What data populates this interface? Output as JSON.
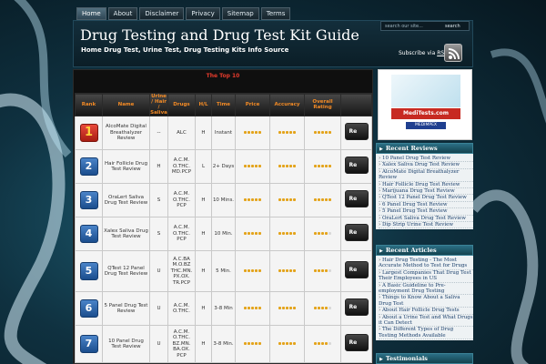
{
  "nav": [
    "Home",
    "About",
    "Disclaimer",
    "Privacy",
    "Sitemap",
    "Terms"
  ],
  "header": {
    "title": "Drug Testing and Drug Test Kit Guide",
    "tagline": "Home Drug Test, Urine Test, Drug Testing Kits Info Source",
    "search_placeholder": "search our site...",
    "search_button": "search",
    "subscribe_text": "Subscribe via",
    "rss_text": "RSS"
  },
  "table": {
    "heading": "The Top 10",
    "columns": [
      "Rank",
      "Name",
      "Urine / Hair / Saliva",
      "Drugs",
      "H/L",
      "Time",
      "Price",
      "Accuracy",
      "Overall Rating",
      ""
    ],
    "review_label": "Re",
    "rows": [
      {
        "rank": "1",
        "name": "AlcoMate Digital Breathalyzer Review",
        "type": "--",
        "drugs": "ALC",
        "hl": "H",
        "time": "Instant",
        "price_stars": 5,
        "accuracy_stars": 5,
        "overall_stars": 5
      },
      {
        "rank": "2",
        "name": "Hair Follicle Drug Test Review",
        "type": "H",
        "drugs": "A.C.M. O.THC. MD.PCP",
        "hl": "L",
        "time": "2+ Days",
        "price_stars": 5,
        "accuracy_stars": 5,
        "overall_stars": 5
      },
      {
        "rank": "3",
        "name": "OraLert Saliva Drug Test Review",
        "type": "S",
        "drugs": "A.C.M. O.THC. PCP",
        "hl": "H",
        "time": "10 Mins.",
        "price_stars": 5,
        "accuracy_stars": 5,
        "overall_stars": 5
      },
      {
        "rank": "4",
        "name": "Xalex Saliva Drug Test Review",
        "type": "S",
        "drugs": "A.C.M. O.THC. PCP",
        "hl": "H",
        "time": "10 Min.",
        "price_stars": 5,
        "accuracy_stars": 5,
        "overall_stars": 4
      },
      {
        "rank": "5",
        "name": "QTest 12 Panel Drug Test Review",
        "type": "U",
        "drugs": "A.C.BA M.O.BZ THC.MN. PX.OX. TR.PCP",
        "hl": "H",
        "time": "5 Min.",
        "price_stars": 5,
        "accuracy_stars": 5,
        "overall_stars": 4
      },
      {
        "rank": "6",
        "name": "5 Panel Drug Test Review",
        "type": "U",
        "drugs": "A.C.M. O.THC.",
        "hl": "H",
        "time": "3-8 Min",
        "price_stars": 5,
        "accuracy_stars": 5,
        "overall_stars": 4
      },
      {
        "rank": "7",
        "name": "10 Panel Drug Test Review",
        "type": "U",
        "drugs": "A.C.M. O.THC. BZ.MN. BA.OX. PCP",
        "hl": "H",
        "time": "3-8 Min.",
        "price_stars": 5,
        "accuracy_stars": 5,
        "overall_stars": 4
      }
    ]
  },
  "ad": {
    "site": "MediTests.com",
    "brand": "MEDIMPEX"
  },
  "sidebar": {
    "recent_reviews_title": "Recent Reviews",
    "recent_reviews": [
      "10 Panel Drug Test Review",
      "Xalex Saliva Drug Test Review",
      "AlcoMate Digital Breathalyzer Review",
      "Hair Follicle Drug Test Review",
      "Marijuana Drug Test Review",
      "QTest 12 Panel Drug Test Review",
      "6 Panel Drug Test Review",
      "5 Panel Drug Test Review",
      "OraLert Saliva Drug Test Review",
      "Dip Strip Urine Test Review"
    ],
    "recent_articles_title": "Recent Articles",
    "recent_articles": [
      "Hair Drug Testing - The Most Accurate Method to Test for Drugs",
      "Largest Companies That Drug Test Their Employees in US",
      "A Basic Guideline to Pre-employment Drug Testing",
      "Things to Know About a Saliva Drug Test",
      "About Hair Follicle Drug Tests",
      "About a Urine Test and What Drugs it Can Detect",
      "The Different Types of Drug Testing Methods Available"
    ],
    "testimonials_title": "Testimonials"
  },
  "colors": {
    "heading_red": "#e53b2c",
    "column_orange": "#f28a25",
    "star_gold": "#e3a31a",
    "badge_blue": "#2b62a8",
    "badge_red": "#c8342a",
    "widget_teal": "#1f5c6e"
  }
}
